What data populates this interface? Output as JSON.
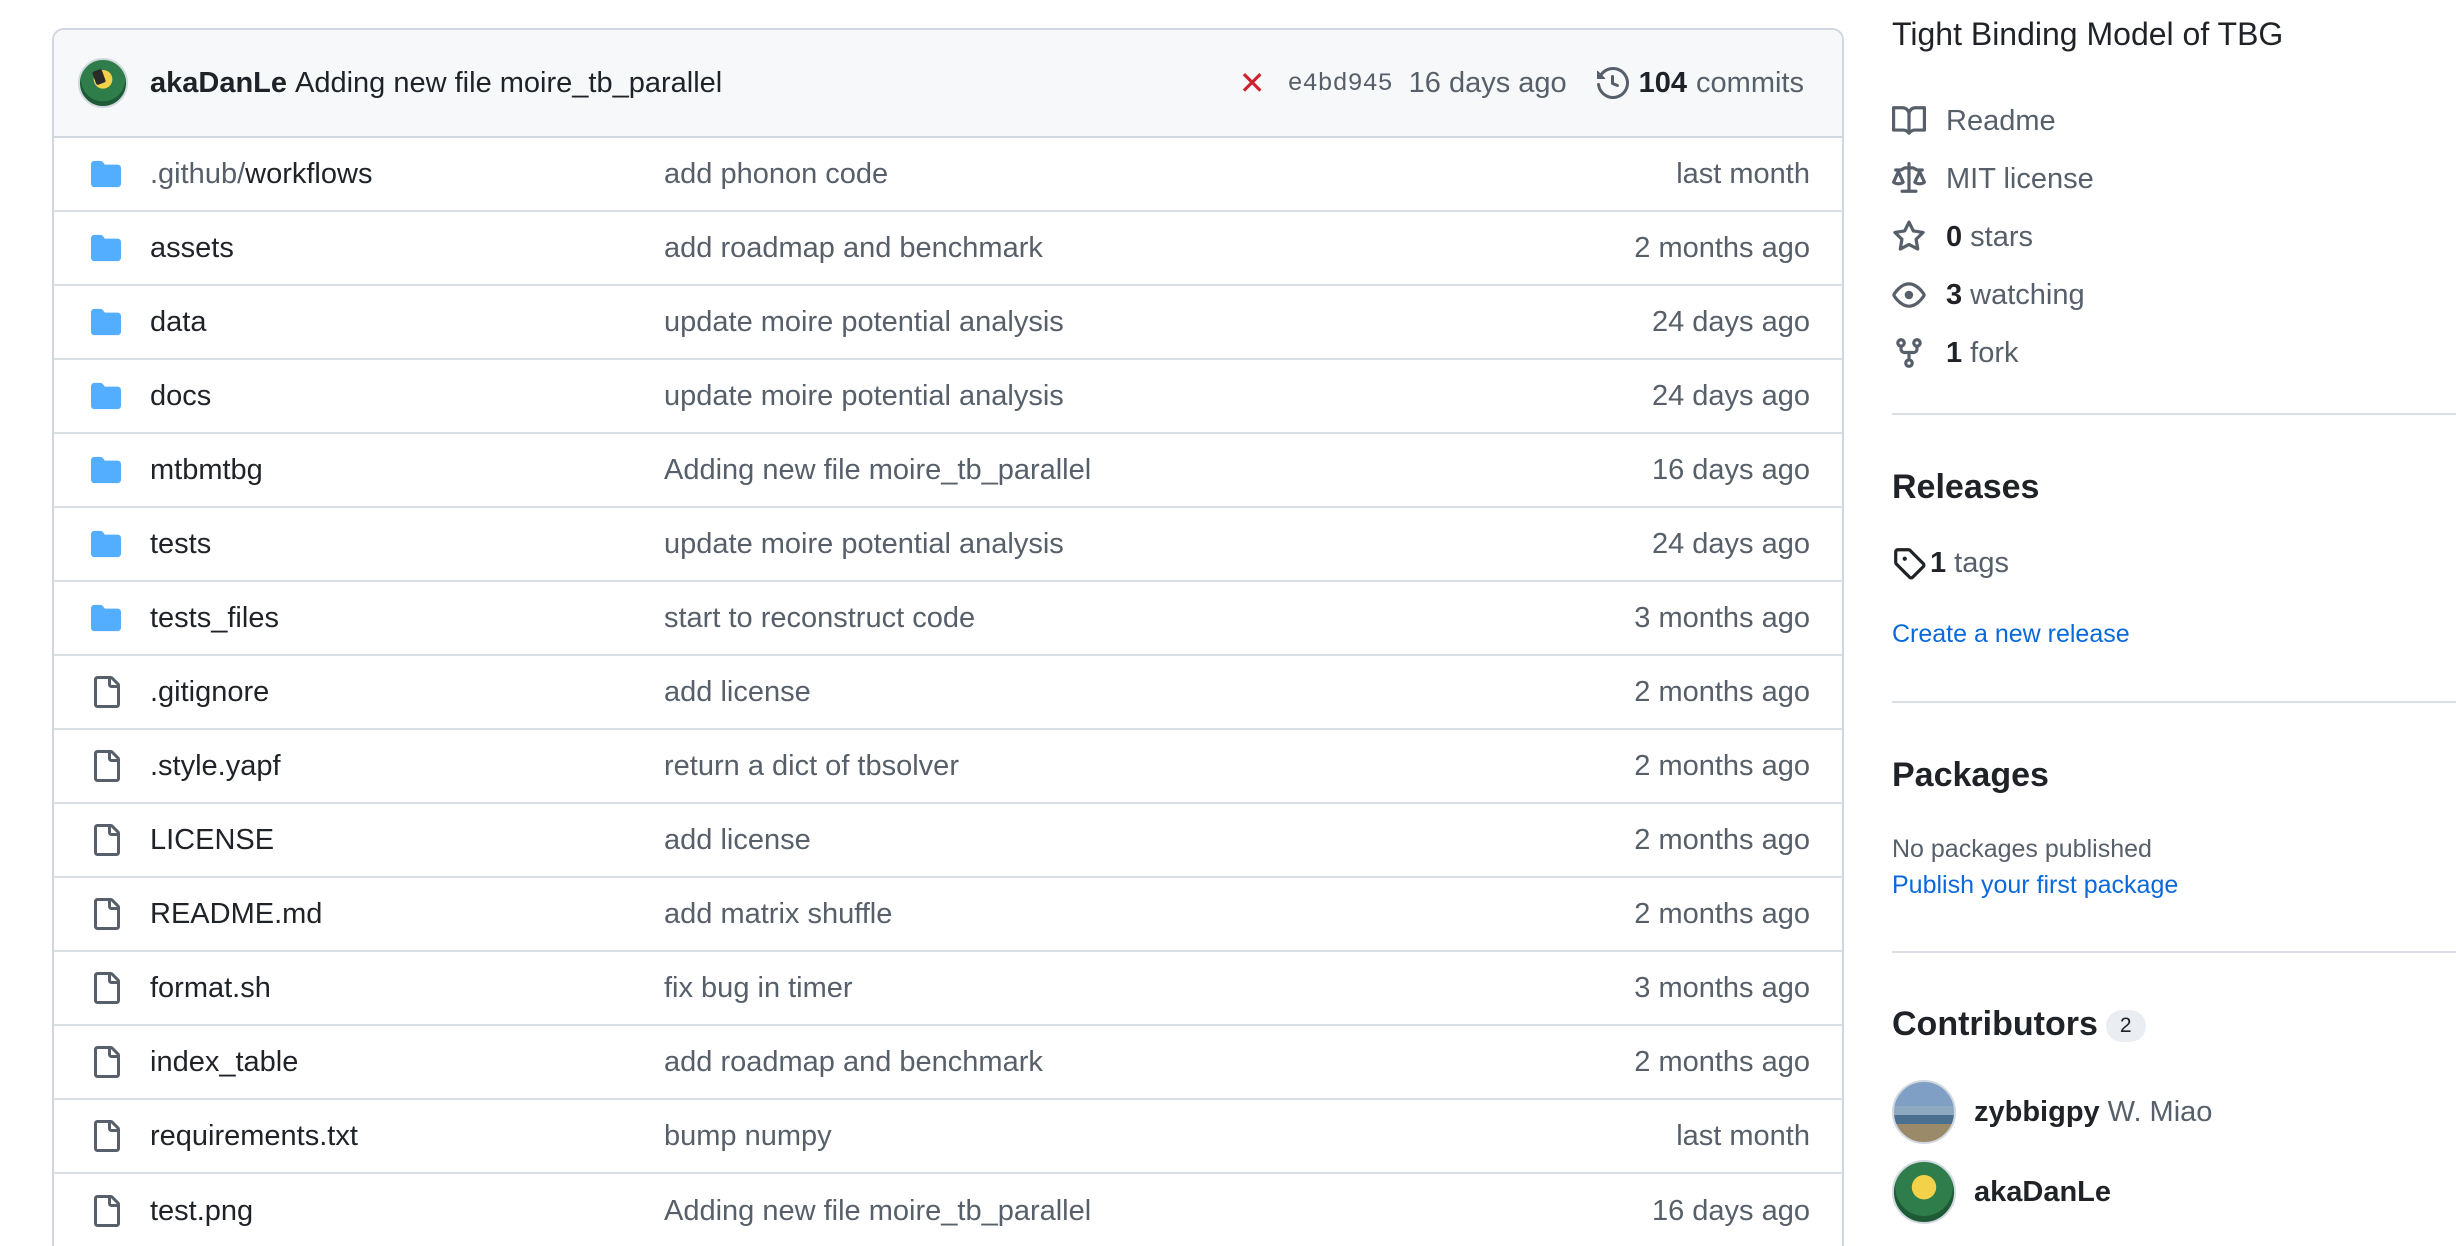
{
  "commit": {
    "author": "akaDanLe",
    "message": "Adding new file moire_tb_parallel",
    "status_icon": "x-icon",
    "sha": "e4bd945",
    "ago": "16 days ago",
    "count": "104",
    "count_label": "commits"
  },
  "files": [
    {
      "type": "dir",
      "name_dim": ".github/",
      "name": "workflows",
      "msg": "add phonon code",
      "age": "last month"
    },
    {
      "type": "dir",
      "name_dim": "",
      "name": "assets",
      "msg": "add roadmap and benchmark",
      "age": "2 months ago"
    },
    {
      "type": "dir",
      "name_dim": "",
      "name": "data",
      "msg": "update moire potential analysis",
      "age": "24 days ago"
    },
    {
      "type": "dir",
      "name_dim": "",
      "name": "docs",
      "msg": "update moire potential analysis",
      "age": "24 days ago"
    },
    {
      "type": "dir",
      "name_dim": "",
      "name": "mtbmtbg",
      "msg": "Adding new file moire_tb_parallel",
      "age": "16 days ago"
    },
    {
      "type": "dir",
      "name_dim": "",
      "name": "tests",
      "msg": "update moire potential analysis",
      "age": "24 days ago"
    },
    {
      "type": "dir",
      "name_dim": "",
      "name": "tests_files",
      "msg": "start to reconstruct code",
      "age": "3 months ago"
    },
    {
      "type": "file",
      "name_dim": "",
      "name": ".gitignore",
      "msg": "add license",
      "age": "2 months ago"
    },
    {
      "type": "file",
      "name_dim": "",
      "name": ".style.yapf",
      "msg": "return a dict of tbsolver",
      "age": "2 months ago"
    },
    {
      "type": "file",
      "name_dim": "",
      "name": "LICENSE",
      "msg": "add license",
      "age": "2 months ago"
    },
    {
      "type": "file",
      "name_dim": "",
      "name": "README.md",
      "msg": "add matrix shuffle",
      "age": "2 months ago"
    },
    {
      "type": "file",
      "name_dim": "",
      "name": "format.sh",
      "msg": "fix bug in timer",
      "age": "3 months ago"
    },
    {
      "type": "file",
      "name_dim": "",
      "name": "index_table",
      "msg": "add roadmap and benchmark",
      "age": "2 months ago"
    },
    {
      "type": "file",
      "name_dim": "",
      "name": "requirements.txt",
      "msg": "bump numpy",
      "age": "last month"
    },
    {
      "type": "file",
      "name_dim": "",
      "name": "test.png",
      "msg": "Adding new file moire_tb_parallel",
      "age": "16 days ago"
    }
  ],
  "about": {
    "description": "Tight Binding Model of TBG",
    "readme": "Readme",
    "license": "MIT license",
    "stars_count": "0",
    "stars_label": "stars",
    "watching_count": "3",
    "watching_label": "watching",
    "fork_count": "1",
    "fork_label": "fork"
  },
  "releases": {
    "title": "Releases",
    "tags_count": "1",
    "tags_label": "tags",
    "create_link": "Create a new release"
  },
  "packages": {
    "title": "Packages",
    "empty": "No packages published",
    "publish_link": "Publish your first package"
  },
  "contributors": {
    "title": "Contributors",
    "count": "2",
    "people": [
      {
        "login": "zybbigpy",
        "full_name": "W. Miao"
      },
      {
        "login": "akaDanLe",
        "full_name": ""
      }
    ]
  },
  "colors": {
    "folder": "#54aeff",
    "link": "#0969da",
    "fail": "#cf222e"
  }
}
